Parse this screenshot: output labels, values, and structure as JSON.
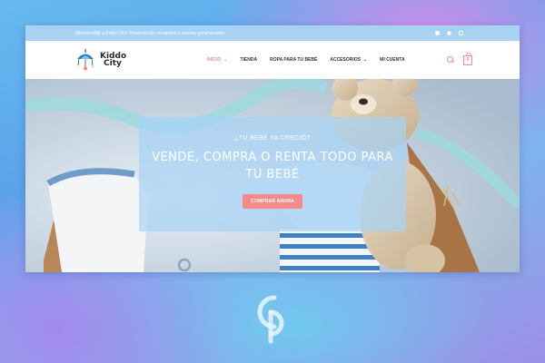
{
  "topbar": {
    "welcome": "¡Bienvenid@ a Kiddo City! Pasamos tus recuerdos a nuevas generaciones",
    "social": [
      "facebook-icon",
      "twitter-icon",
      "instagram-icon"
    ]
  },
  "header": {
    "logo_line1": "Kiddo",
    "logo_line2": "City",
    "nav": [
      {
        "label": "INICIO",
        "dropdown": true,
        "active": true
      },
      {
        "label": "TIENDA",
        "dropdown": false,
        "active": false
      },
      {
        "label": "ROPA PARA TU BEBÉ",
        "dropdown": false,
        "active": false
      },
      {
        "label": "ACCESORIOS",
        "dropdown": true,
        "active": false
      },
      {
        "label": "MI CUENTA",
        "dropdown": false,
        "active": false
      }
    ],
    "cart_count": "0"
  },
  "hero": {
    "subtitle": "¿TU BEBÉ YA CRECIÓ?",
    "title": "VENDE, COMPRA O RENTA TODO PARA TU BEBÉ",
    "cta": "COMPRAR AHORA"
  },
  "colors": {
    "topbar": "#a8d2f3",
    "accent": "#f58a8a",
    "overlay": "#a8d2f5"
  }
}
